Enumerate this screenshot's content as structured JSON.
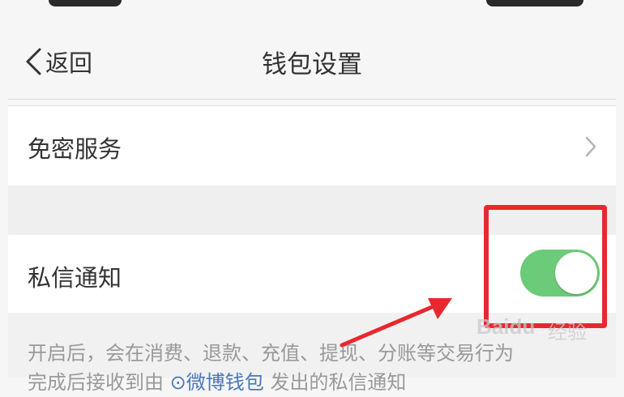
{
  "nav": {
    "back_label": "返回",
    "title": "钱包设置"
  },
  "rows": {
    "password_free": {
      "label": "免密服务"
    },
    "private_message": {
      "label": "私信通知",
      "enabled": true
    }
  },
  "description": {
    "line1": "开启后，会在消费、退款、充值、提现、分账等交易行为",
    "line2_prefix": "完成后接收到由",
    "line2_link": "微博钱包",
    "line2_suffix": "发出的私信通知"
  },
  "watermark": {
    "brand": "Baidu",
    "suffix": "经验"
  },
  "colors": {
    "toggle_on": "#6ccb78",
    "annotation": "#e8282e",
    "link": "#4a78b8"
  }
}
